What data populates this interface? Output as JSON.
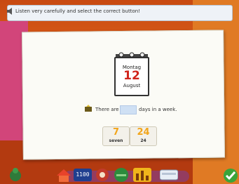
{
  "instruction": "Listen very carefully and select the correct button!",
  "calendar": {
    "day": "Montag",
    "number": "12",
    "month": "August"
  },
  "question": {
    "before": "There are",
    "after": "days in a week."
  },
  "answers": [
    {
      "numeral": "7",
      "label": "seven"
    },
    {
      "numeral": "24",
      "label": "24"
    }
  ],
  "toolbar": {
    "clock_text": "1100"
  },
  "colors": {
    "accent": "#f2a51b",
    "calendar_red": "#d0241c",
    "check_green": "#3aa43a"
  }
}
